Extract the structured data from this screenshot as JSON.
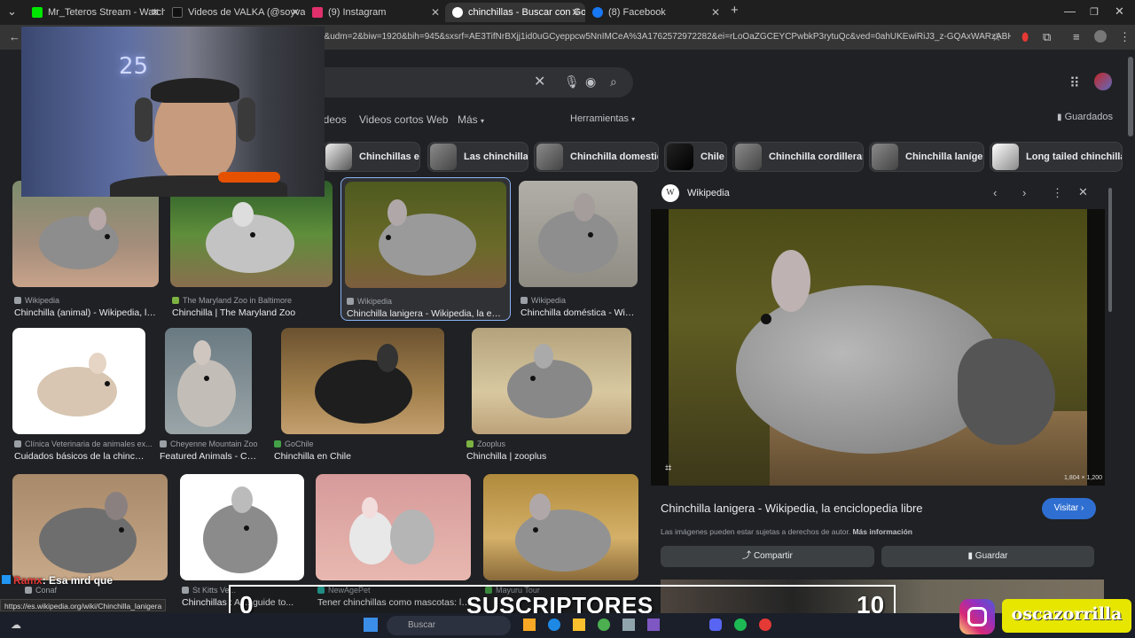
{
  "browser": {
    "tabs": [
      {
        "label": "Mr_Teteros Stream - Watch Live",
        "color": "#00e701"
      },
      {
        "label": "Videos de VALKA (@soyvalka) d",
        "color": "#111111"
      },
      {
        "label": "(9) Instagram",
        "color": "#e1306c"
      },
      {
        "label": "chinchillas - Buscar con Google",
        "color": "#ffffff"
      },
      {
        "label": "(8) Facebook",
        "color": "#1877f2"
      }
    ],
    "url": "d&udm=2&biw=1920&bih=945&sxsrf=AE3TifNrBXjj1id0uGCyeppcw5NnIMCeA%3A1762572972282&ei=rLoOaZGCEYCPwbkP3rytuQc&ved=0ahUKEwiRiJ3_z-GQAxWARzABHV5e...",
    "status_url": "https://es.wikipedia.org/wiki/Chinchilla_lanigera"
  },
  "search": {
    "nav_tabs": [
      "ideos",
      "Videos cortos",
      "Web",
      "Más"
    ],
    "tools_label": "Herramientas",
    "saved_label": "Guardados",
    "chips": [
      "Chinchillas eat",
      "Las chinchillas",
      "Chinchilla domestica",
      "Chile",
      "Chinchilla cordillerana",
      "Chinchilla lanígera",
      "Long tailed chinchilla"
    ]
  },
  "results": [
    {
      "source": "Wikipedia",
      "title": "Chinchilla (animal) - Wikipedia, la ..."
    },
    {
      "source": "The Maryland Zoo in Baltimore",
      "title": "Chinchilla | The Maryland Zoo"
    },
    {
      "source": "Wikipedia",
      "title": "Chinchilla lanigera - Wikipedia, la encic..."
    },
    {
      "source": "Wikipedia",
      "title": "Chinchilla doméstica - Wiki..."
    },
    {
      "source": "Clínica Veterinaria de animales ex...",
      "title": "Cuidados básicos de la chinchil..."
    },
    {
      "source": "Cheyenne Mountain Zoo",
      "title": "Featured Animals - Chi..."
    },
    {
      "source": "GoChile",
      "title": "Chinchilla en Chile"
    },
    {
      "source": "Zooplus",
      "title": "Chinchilla | zooplus"
    },
    {
      "source": "Conaf",
      "title": ""
    },
    {
      "source": "St Kitts Ve...",
      "title": "Chinchillas : A ... guide to..."
    },
    {
      "source": "NewAgePet",
      "title": "Tener chinchillas como mascotas: lo ..."
    },
    {
      "source": "Mayuru Tour",
      "title": ""
    }
  ],
  "preview": {
    "source": "Wikipedia",
    "dimensions": "1,804 × 1,200",
    "title": "Chinchilla lanigera - Wikipedia, la enciclopedia libre",
    "visit_label": "Visitar",
    "copyright": "Las imágenes pueden estar sujetas a derechos de autor.",
    "more_info": "Más información",
    "share_label": "Compartir",
    "save_label": "Guardar"
  },
  "overlay": {
    "chat_user": "Ramx",
    "chat_message": ": Esa mrd que",
    "subs_left": "0",
    "subs_label": "SUSCRIPTORES",
    "subs_right": "10",
    "handle": "oscazorrilla",
    "taskbar_search": "Buscar",
    "webcam_badge": "25"
  }
}
